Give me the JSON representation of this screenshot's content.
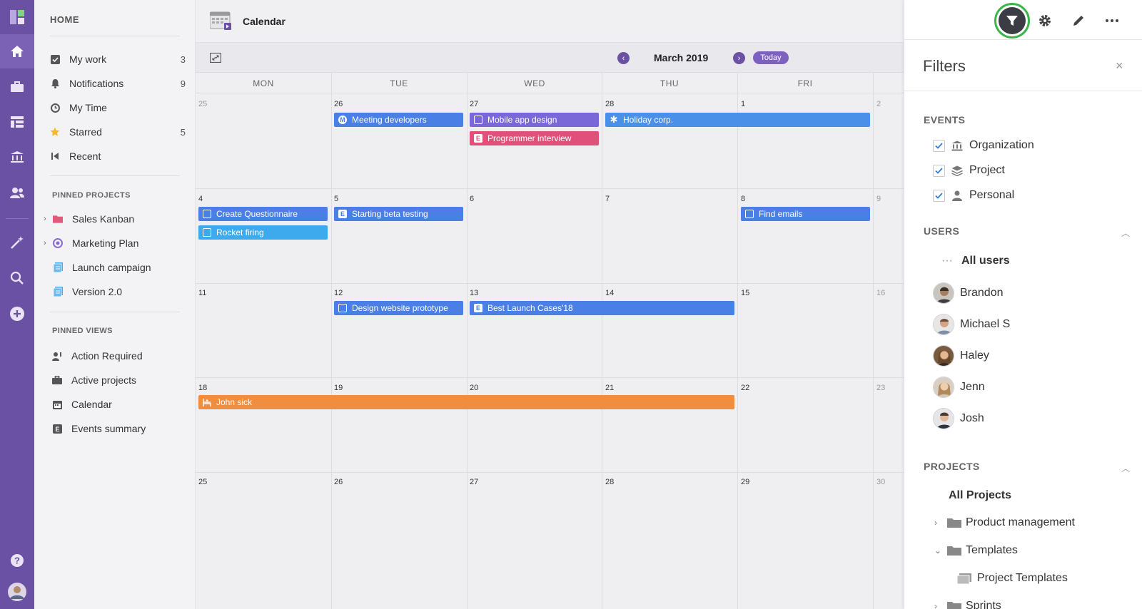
{
  "sidebar": {
    "home": "HOME",
    "items": [
      {
        "label": "My work",
        "count": "3"
      },
      {
        "label": "Notifications",
        "count": "9"
      },
      {
        "label": "My Time",
        "count": ""
      },
      {
        "label": "Starred",
        "count": "5"
      },
      {
        "label": "Recent",
        "count": ""
      }
    ],
    "pinned_projects_title": "PINNED PROJECTS",
    "pinned_projects": [
      "Sales Kanban",
      "Marketing Plan",
      "Launch campaign",
      "Version 2.0"
    ],
    "pinned_views_title": "PINNED VIEWS",
    "pinned_views": [
      "Action Required",
      "Active projects",
      "Calendar",
      "Events summary"
    ]
  },
  "calendar": {
    "title": "Calendar",
    "month": "March 2019",
    "today": "Today",
    "prev": "‹",
    "next": "›",
    "weekdays": [
      "MON",
      "TUE",
      "WED",
      "THU",
      "FRI"
    ],
    "weeks": [
      [
        "25",
        "26",
        "27",
        "28",
        "1",
        "2"
      ],
      [
        "4",
        "5",
        "6",
        "7",
        "8",
        "9"
      ],
      [
        "11",
        "12",
        "13",
        "14",
        "15",
        "16"
      ],
      [
        "18",
        "19",
        "20",
        "21",
        "22",
        "23"
      ],
      [
        "25",
        "26",
        "27",
        "28",
        "29",
        "30"
      ]
    ],
    "events": [
      {
        "label": "Meeting developers",
        "icon": "M"
      },
      {
        "label": "Mobile app design",
        "icon": "box"
      },
      {
        "label": "Holiday corp.",
        "icon": "snowflake"
      },
      {
        "label": "Programmer interview",
        "icon": "E"
      },
      {
        "label": "Create Questionnaire",
        "icon": "box"
      },
      {
        "label": "Starting beta testing",
        "icon": "E"
      },
      {
        "label": "Find emails",
        "icon": "box"
      },
      {
        "label": "Rocket firing",
        "icon": "box"
      },
      {
        "label": "Design website prototype",
        "icon": "box"
      },
      {
        "label": "Best Launch Cases'18",
        "icon": "E"
      },
      {
        "label": "John sick",
        "icon": "sick"
      }
    ],
    "colors": {
      "blue": "#4a7fe6",
      "purple": "#7a67d8",
      "pink": "#e0507a",
      "light_blue": "#3eaaee",
      "orange": "#f08d3e"
    }
  },
  "filters": {
    "title": "Filters",
    "close": "×",
    "events_title": "EVENTS",
    "events": [
      "Organization",
      "Project",
      "Personal"
    ],
    "users_title": "USERS",
    "all_users": "All users",
    "all_users_icon": "···",
    "users": [
      "Brandon",
      "Michael S",
      "Haley",
      "Jenn",
      "Josh"
    ],
    "projects_title": "PROJECTS",
    "all_projects": "All Projects",
    "projects": [
      "Product management",
      "Templates",
      "Project Templates",
      "Sprints"
    ],
    "collapse": "︿"
  },
  "accent": "#6b51a3",
  "highlight": "#39b54a"
}
